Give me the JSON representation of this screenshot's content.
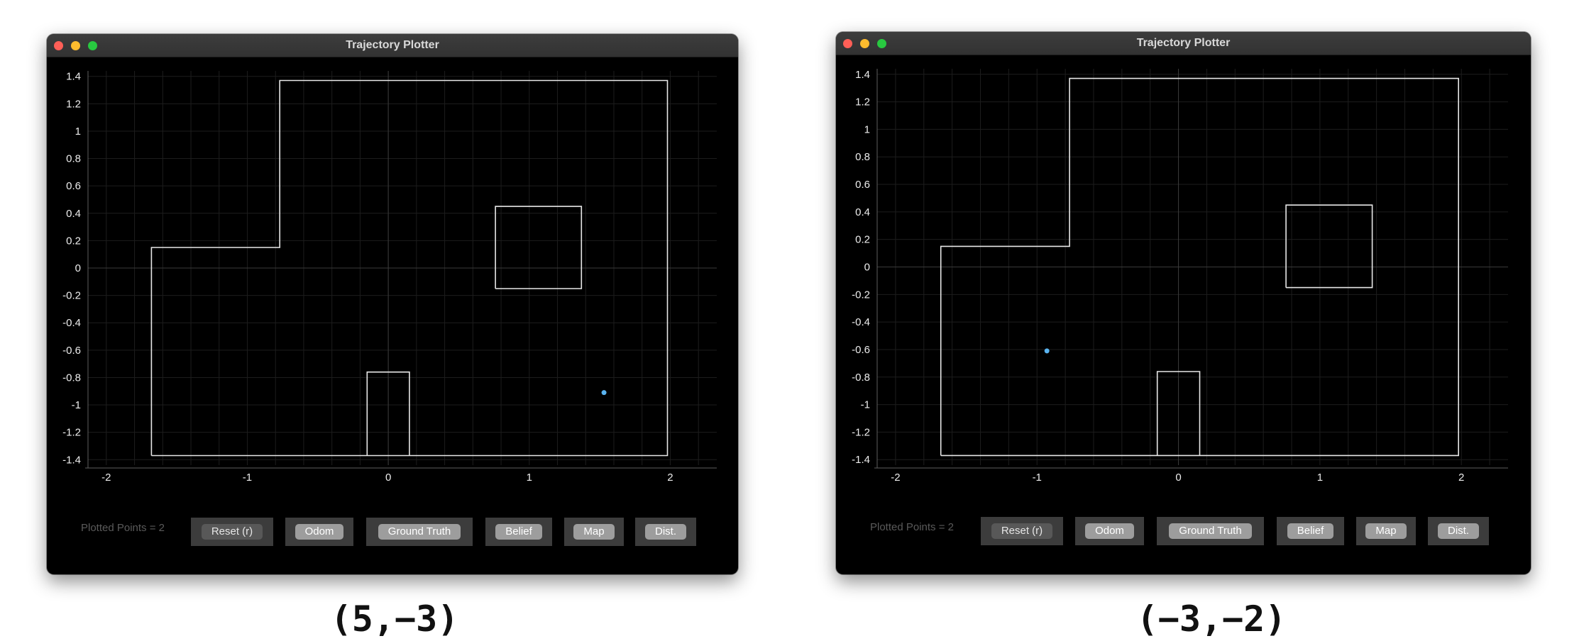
{
  "panels": [
    {
      "window_title": "Trajectory Plotter",
      "plotted_points_text": "Plotted Points = 2",
      "buttons": [
        {
          "label": "Reset (r)",
          "style": "dark"
        },
        {
          "label": "Odom",
          "style": "light"
        },
        {
          "label": "Ground Truth",
          "style": "light"
        },
        {
          "label": "Belief",
          "style": "light"
        },
        {
          "label": "Map",
          "style": "light"
        },
        {
          "label": "Dist.",
          "style": "light"
        }
      ],
      "robot_point": {
        "x": 1.53,
        "y": -0.91,
        "color": "#5ab4f0"
      },
      "caption": "(5,−3)"
    },
    {
      "window_title": "Trajectory Plotter",
      "plotted_points_text": "Plotted Points = 2",
      "buttons": [
        {
          "label": "Reset (r)",
          "style": "dark"
        },
        {
          "label": "Odom",
          "style": "light"
        },
        {
          "label": "Ground Truth",
          "style": "light"
        },
        {
          "label": "Belief",
          "style": "light"
        },
        {
          "label": "Map",
          "style": "light"
        },
        {
          "label": "Dist.",
          "style": "light"
        }
      ],
      "robot_point": {
        "x": -0.93,
        "y": -0.61,
        "color": "#5ab4f0"
      },
      "caption": "(−3,−2)"
    }
  ],
  "chart_data": {
    "type": "line",
    "xlim": [
      -2.13,
      2.33
    ],
    "ylim": [
      -1.44,
      1.44
    ],
    "x_ticks": [
      "-2",
      "-1",
      "0",
      "1",
      "2"
    ],
    "y_ticks": [
      "1.4",
      "1.2",
      "1",
      "0.8",
      "0.6",
      "0.4",
      "0.2",
      "0",
      "-0.2",
      "-0.4",
      "-0.6",
      "-0.8",
      "-1",
      "-1.2",
      "-1.4"
    ],
    "grid": true,
    "map_outline": [
      [
        -1.68,
        -1.37
      ],
      [
        -1.68,
        0.15
      ],
      [
        -0.77,
        0.15
      ],
      [
        -0.77,
        1.37
      ],
      [
        1.98,
        1.37
      ],
      [
        1.98,
        -1.37
      ],
      [
        -1.68,
        -1.37
      ]
    ],
    "obstacle_box": [
      [
        0.76,
        -0.15
      ],
      [
        0.76,
        0.45
      ],
      [
        1.37,
        0.45
      ],
      [
        1.37,
        -0.15
      ],
      [
        0.76,
        -0.15
      ]
    ],
    "bottom_box": [
      [
        -0.15,
        -1.37
      ],
      [
        -0.15,
        -0.76
      ],
      [
        0.15,
        -0.76
      ],
      [
        0.15,
        -1.37
      ]
    ]
  }
}
